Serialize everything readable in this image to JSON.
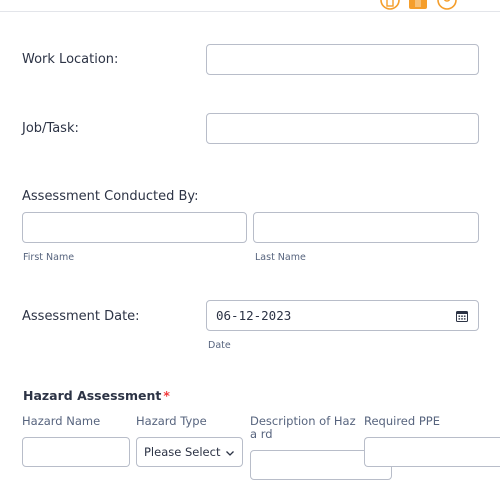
{
  "form": {
    "work_location": {
      "label": "Work Location:",
      "value": ""
    },
    "job_task": {
      "label": "Job/Task:",
      "value": ""
    },
    "conducted_by": {
      "label": "Assessment Conducted By:",
      "first_name_sublabel": "First Name",
      "last_name_sublabel": "Last Name",
      "first_name_value": "",
      "last_name_value": ""
    },
    "assessment_date": {
      "label": "Assessment Date:",
      "value": "06-12-2023",
      "sublabel": "Date",
      "icon": "calendar-icon"
    },
    "hazard_assessment": {
      "title": "Hazard Assessment",
      "required_marker": "*",
      "columns": [
        "Hazard Name",
        "Hazard Type",
        "Description of Haza rd",
        "Required PPE"
      ],
      "hazard_type_selected": "Please Select"
    }
  },
  "colors": {
    "border": "#b8bdc9",
    "text": "#2c3345",
    "required": "#f23a3c",
    "brand_orange": "#f59e2b"
  },
  "header_icons": [
    "person-door-icon",
    "person-orange-icon",
    "person-circle-icon"
  ]
}
